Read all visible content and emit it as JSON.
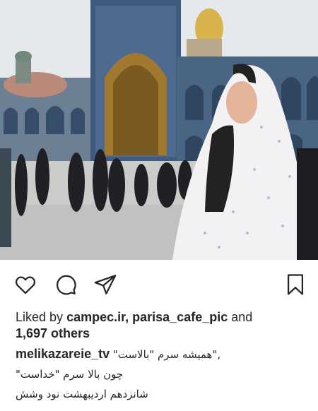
{
  "post": {
    "photo_alt": "",
    "likes": {
      "prefix": "Liked by",
      "user1": "campec.ir,",
      "user2": "parisa_cafe_pic",
      "conj": "and",
      "others": "1,697 others"
    },
    "caption": {
      "username": "melikazareie_tv",
      "line1": "\"همیشه سرم \"بالاست\",",
      "line2": "چون  بالا سرم  \"خداست\"",
      "line3": "شانزدهم اردیبهشت نود وشش"
    }
  },
  "icons": {
    "like": "heart-icon",
    "comment": "comment-icon",
    "share": "paper-plane-icon",
    "save": "bookmark-icon"
  },
  "colors": {
    "text": "#262626",
    "background": "#ffffff"
  }
}
